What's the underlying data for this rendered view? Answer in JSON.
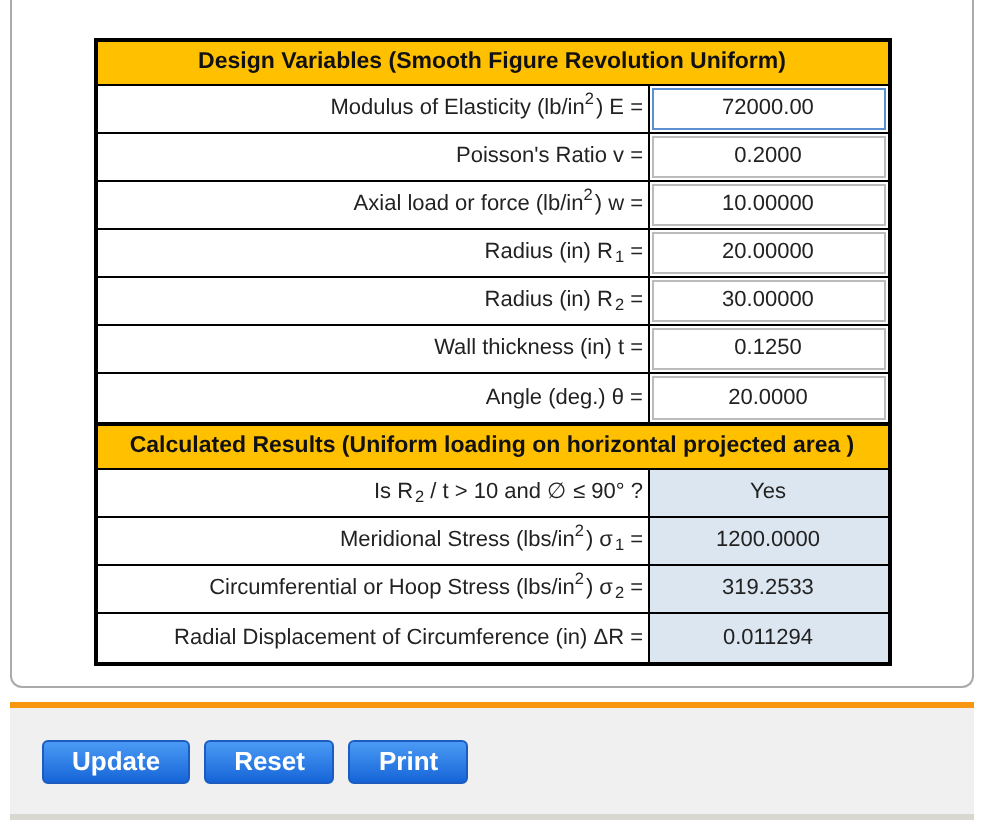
{
  "design_variables": {
    "title": "Design Variables (Smooth Figure Revolution Uniform)",
    "rows": [
      {
        "label": "Modulus of Elasticity (lb/in$^{2}$) E =",
        "value": "72000.00",
        "focused": true
      },
      {
        "label": "Poisson's Ratio v =",
        "value": "0.2000",
        "focused": false
      },
      {
        "label": "Axial load or force (lb/in$^{2}$) w =",
        "value": "10.00000",
        "focused": false
      },
      {
        "label": "Radius (in)  R$_{1}$ =",
        "value": "20.00000",
        "focused": false
      },
      {
        "label": "Radius (in)  R$_{2}$ =",
        "value": "30.00000",
        "focused": false
      },
      {
        "label": "Wall thickness (in) t =",
        "value": "0.1250",
        "focused": false
      },
      {
        "label": "Angle (deg.) θ =",
        "value": "20.0000",
        "focused": false
      }
    ]
  },
  "calculated_results": {
    "title": "Calculated Results (Uniform loading on horizontal projected area )",
    "rows": [
      {
        "label": "Is R$_{2}$ / t > 10 and ∅ ≤ 90° ?",
        "value": "Yes"
      },
      {
        "label": "Meridional Stress (lbs/in$^{2}$) σ$_{1}$ =",
        "value": "1200.0000"
      },
      {
        "label": "Circumferential or Hoop Stress (lbs/in$^{2}$) σ$_{2}$ =",
        "value": "319.2533"
      },
      {
        "label": "Radial Displacement of Circumference (in) ΔR =",
        "value": "0.011294"
      }
    ]
  },
  "buttons": [
    "Update",
    "Reset",
    "Print"
  ]
}
